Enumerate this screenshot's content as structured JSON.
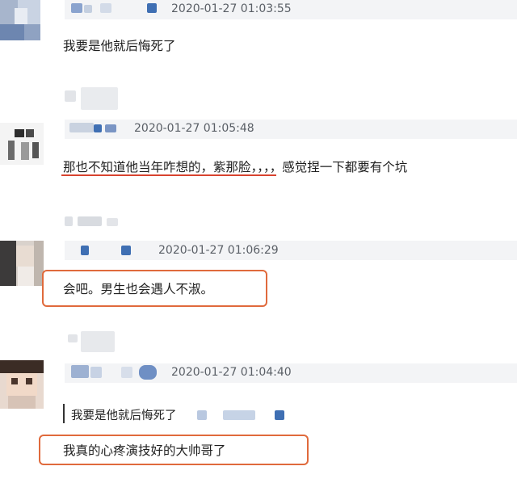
{
  "thread": {
    "comments": [
      {
        "timestamp": "2020-01-27 01:03:55",
        "text": "我要是他就后悔死了"
      },
      {
        "timestamp": "2020-01-27 01:05:48",
        "text": "那也不知道他当年咋想的，紫那脸，，，，感觉捏一下都要有个坑"
      },
      {
        "timestamp": "2020-01-27 01:06:29",
        "text": "会吧。男生也会遇人不淑。"
      },
      {
        "timestamp": "2020-01-27 01:04:40",
        "quote": "我要是他就后悔死了",
        "text": "我真的心疼演技好的大帅哥了"
      }
    ]
  },
  "colors": {
    "header_bg": "#f3f4f6",
    "timestamp": "#5a5f66",
    "highlight_box": "#e06a3c",
    "underline": "#d8432f",
    "blur_blue": "#3f6fb3"
  }
}
